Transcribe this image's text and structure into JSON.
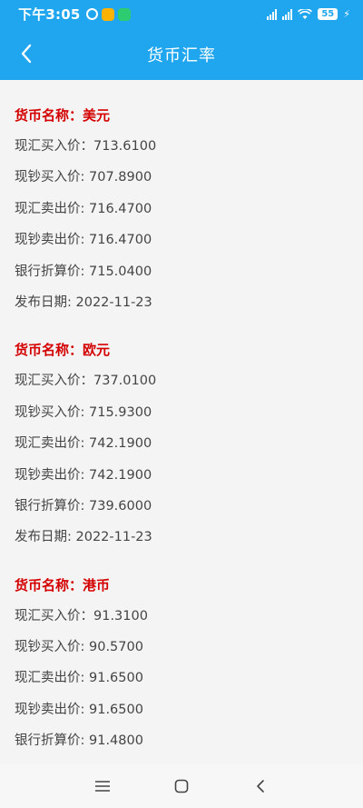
{
  "status_bar": {
    "time": "下午3:05",
    "battery": "55"
  },
  "header": {
    "title": "货币汇率"
  },
  "currencies": [
    {
      "name": "货币名称：美元",
      "rows": [
        "现汇买入价：713.6100",
        "现钞买入价: 707.8900",
        "现汇卖出价: 716.4700",
        "现钞卖出价: 716.4700",
        "银行折算价: 715.0400",
        "发布日期: 2022-11-23"
      ]
    },
    {
      "name": "货币名称：欧元",
      "rows": [
        "现汇买入价：737.0100",
        "现钞买入价: 715.9300",
        "现汇卖出价: 742.1900",
        "现钞卖出价: 742.1900",
        "银行折算价: 739.6000",
        "发布日期: 2022-11-23"
      ]
    },
    {
      "name": "货币名称：港币",
      "rows": [
        "现汇买入价：91.3100",
        "现钞买入价: 90.5700",
        "现汇卖出价: 91.6500",
        "现钞卖出价: 91.6500",
        "银行折算价: 91.4800"
      ]
    }
  ],
  "colors": {
    "accent": "#1fa6ef",
    "currency_name": "#d40000"
  }
}
